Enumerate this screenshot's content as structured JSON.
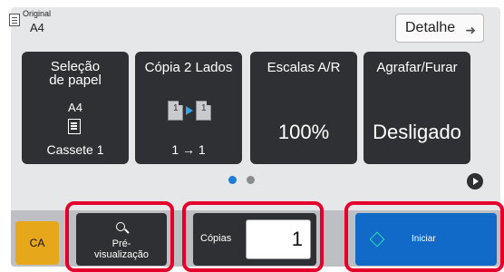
{
  "original": {
    "label": "Original",
    "value": "A4",
    "icon": "original-document-icon"
  },
  "detail_button": {
    "label": "Detalhe",
    "icon": "arrow-right-icon"
  },
  "tiles": [
    {
      "title": "Seleção\nde papel",
      "size": "A4",
      "tray": "Cassete 1",
      "icon": "paper-tray-icon"
    },
    {
      "title": "Cópia 2 Lados",
      "value": "1 → 1",
      "icon": "duplex-copy-icon"
    },
    {
      "title": "Escalas A/R",
      "value": "100%"
    },
    {
      "title": "Agrafar/Furar",
      "value": "Desligado"
    }
  ],
  "pager": {
    "total": 2,
    "active": 1,
    "next_icon": "play-next-icon"
  },
  "bottom": {
    "ca_label": "CA",
    "preview_label": "Pré-\nvisualização",
    "preview_icon": "preview-magnifier-icon",
    "copies_label": "Cópias",
    "copies_value": "1",
    "start_label": "Iniciar",
    "start_icon": "start-diamond-icon"
  },
  "colors": {
    "tile_bg": "#2f3033",
    "accent_blue": "#1169c8",
    "ca_orange": "#e6a71a",
    "highlight_red": "#e4002b"
  }
}
